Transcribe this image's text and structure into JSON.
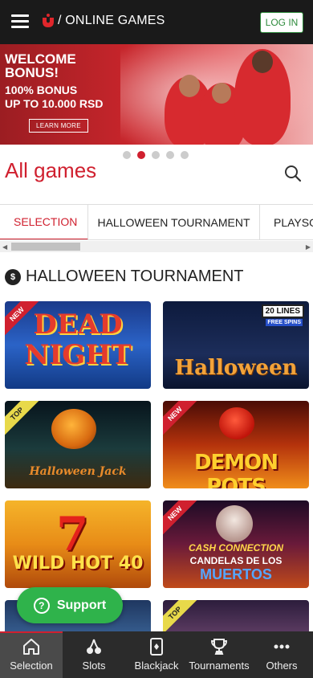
{
  "header": {
    "brand": "/ ONLINE GAMES",
    "login_label": "LOG IN"
  },
  "banner": {
    "line1": "WELCOME",
    "line2": "BONUS!",
    "line3": "100% BONUS",
    "line4": "UP TO 10.000 RSD",
    "cta": "LEARN MORE"
  },
  "carousel": {
    "count": 5,
    "active_index": 1
  },
  "page": {
    "title": "All games"
  },
  "tabs": [
    {
      "label": "SELECTION",
      "active": true
    },
    {
      "label": "HALLOWEEN TOURNAMENT",
      "active": false
    },
    {
      "label": "PLAYSO",
      "active": false
    }
  ],
  "section": {
    "title": "HALLOWEEN TOURNAMENT"
  },
  "games": [
    {
      "title": "DEAD NIGHT",
      "badge": "NEW"
    },
    {
      "title": "Halloween",
      "badge": "",
      "lines": "20 LINES",
      "extra": "FREE SPINS"
    },
    {
      "title": "Halloween Jack",
      "badge": "TOP"
    },
    {
      "title": "DEMON POTS",
      "badge": "NEW"
    },
    {
      "title": "WILD HOT 40",
      "badge": "",
      "symbol": "7"
    },
    {
      "title_a": "CASH CONNECTION",
      "title_b": "CANDELAS DE LOS",
      "title_c": "MUERTOS",
      "badge": "NEW"
    },
    {
      "badge": ""
    },
    {
      "badge": "TOP"
    }
  ],
  "support": {
    "label": "Support"
  },
  "bottom_nav": [
    {
      "label": "Selection",
      "icon": "home-icon",
      "active": true
    },
    {
      "label": "Slots",
      "icon": "cherries-icon",
      "active": false
    },
    {
      "label": "Blackjack",
      "icon": "card-icon",
      "active": false
    },
    {
      "label": "Tournaments",
      "icon": "trophy-icon",
      "active": false
    },
    {
      "label": "Others",
      "icon": "more-icon",
      "active": false
    }
  ],
  "colors": {
    "accent": "#d0202f",
    "header_bg": "#1a1a1a",
    "support": "#2fb34b",
    "nav_bg": "#2b2b2b"
  }
}
